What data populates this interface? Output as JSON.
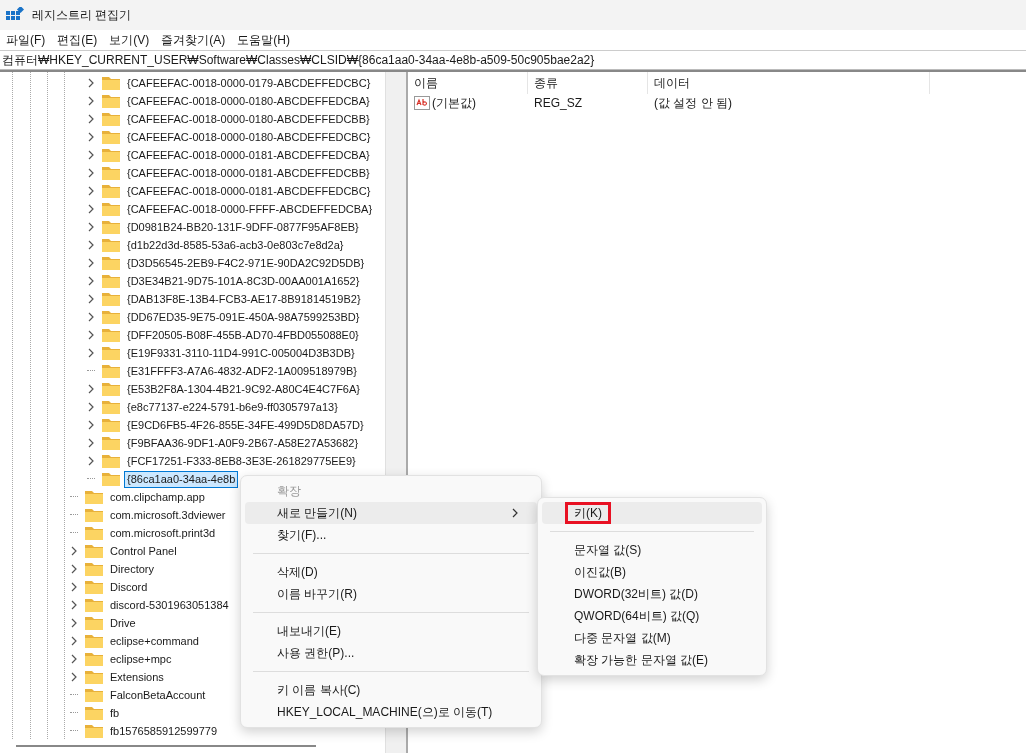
{
  "window": {
    "title": "레지스트리 편집기"
  },
  "menu_bar": [
    "파일(F)",
    "편집(E)",
    "보기(V)",
    "즐겨찾기(A)",
    "도움말(H)"
  ],
  "address": "컴퓨터₩HKEY_CURRENT_USER₩Software₩Classes₩CLSID₩{86ca1aa0-34aa-4e8b-a509-50c905bae2a2}",
  "tree": {
    "clsid_children": [
      {
        "label": "{CAFEEFAC-0018-0000-0179-ABCDEFFEDCBC}",
        "has_children": true,
        "selected": false
      },
      {
        "label": "{CAFEEFAC-0018-0000-0180-ABCDEFFEDCBA}",
        "has_children": true,
        "selected": false
      },
      {
        "label": "{CAFEEFAC-0018-0000-0180-ABCDEFFEDCBB}",
        "has_children": true,
        "selected": false
      },
      {
        "label": "{CAFEEFAC-0018-0000-0180-ABCDEFFEDCBC}",
        "has_children": true,
        "selected": false
      },
      {
        "label": "{CAFEEFAC-0018-0000-0181-ABCDEFFEDCBA}",
        "has_children": true,
        "selected": false
      },
      {
        "label": "{CAFEEFAC-0018-0000-0181-ABCDEFFEDCBB}",
        "has_children": true,
        "selected": false
      },
      {
        "label": "{CAFEEFAC-0018-0000-0181-ABCDEFFEDCBC}",
        "has_children": true,
        "selected": false
      },
      {
        "label": "{CAFEEFAC-0018-0000-FFFF-ABCDEFFEDCBA}",
        "has_children": true,
        "selected": false
      },
      {
        "label": "{D0981B24-BB20-131F-9DFF-0877F95AF8EB}",
        "has_children": true,
        "selected": false
      },
      {
        "label": "{d1b22d3d-8585-53a6-acb3-0e803c7e8d2a}",
        "has_children": true,
        "selected": false
      },
      {
        "label": "{D3D56545-2EB9-F4C2-971E-90DA2C92D5DB}",
        "has_children": true,
        "selected": false
      },
      {
        "label": "{D3E34B21-9D75-101A-8C3D-00AA001A1652}",
        "has_children": true,
        "selected": false
      },
      {
        "label": "{DAB13F8E-13B4-FCB3-AE17-8B91814519B2}",
        "has_children": true,
        "selected": false
      },
      {
        "label": "{DD67ED35-9E75-091E-450A-98A7599253BD}",
        "has_children": true,
        "selected": false
      },
      {
        "label": "{DFF20505-B08F-455B-AD70-4FBD055088E0}",
        "has_children": true,
        "selected": false
      },
      {
        "label": "{E19F9331-3110-11D4-991C-005004D3B3DB}",
        "has_children": true,
        "selected": false
      },
      {
        "label": "{E31FFFF3-A7A6-4832-ADF2-1A009518979B}",
        "has_children": false,
        "selected": false
      },
      {
        "label": "{E53B2F8A-1304-4B21-9C92-A80C4E4C7F6A}",
        "has_children": true,
        "selected": false
      },
      {
        "label": "{e8c77137-e224-5791-b6e9-ff0305797a13}",
        "has_children": true,
        "selected": false
      },
      {
        "label": "{E9CD6FB5-4F26-855E-34FE-499D5D8DA57D}",
        "has_children": true,
        "selected": false
      },
      {
        "label": "{F9BFAA36-9DF1-A0F9-2B67-A58E27A53682}",
        "has_children": true,
        "selected": false
      },
      {
        "label": "{FCF17251-F333-8EB8-3E3E-261829775EE9}",
        "has_children": true,
        "selected": false
      },
      {
        "label": "{86ca1aa0-34aa-4e8b",
        "has_children": false,
        "selected": true
      }
    ],
    "siblings": [
      {
        "label": "com.clipchamp.app",
        "has_children": false,
        "selected": false
      },
      {
        "label": "com.microsoft.3dviewer",
        "has_children": false,
        "selected": false
      },
      {
        "label": "com.microsoft.print3d",
        "has_children": false,
        "selected": false
      },
      {
        "label": "Control Panel",
        "has_children": true,
        "selected": false
      },
      {
        "label": "Directory",
        "has_children": true,
        "selected": false
      },
      {
        "label": "Discord",
        "has_children": true,
        "selected": false
      },
      {
        "label": "discord-5301963051384",
        "has_children": true,
        "selected": false
      },
      {
        "label": "Drive",
        "has_children": true,
        "selected": false
      },
      {
        "label": "eclipse+command",
        "has_children": true,
        "selected": false
      },
      {
        "label": "eclipse+mpc",
        "has_children": true,
        "selected": false
      },
      {
        "label": "Extensions",
        "has_children": true,
        "selected": false
      },
      {
        "label": "FalconBetaAccount",
        "has_children": false,
        "selected": false
      },
      {
        "label": "fb",
        "has_children": false,
        "selected": false
      },
      {
        "label": "fb1576585912599779",
        "has_children": false,
        "selected": false
      }
    ]
  },
  "values": {
    "columns": [
      "이름",
      "종류",
      "데이터"
    ],
    "rows": [
      {
        "name": "(기본값)",
        "type": "REG_SZ",
        "data": "(값 설정 안 됨)"
      }
    ]
  },
  "context_menu": {
    "items": [
      {
        "kind": "item",
        "label": "확장",
        "disabled": true,
        "hovered": false,
        "submenu": false
      },
      {
        "kind": "item",
        "label": "새로 만들기(N)",
        "disabled": false,
        "hovered": true,
        "submenu": true
      },
      {
        "kind": "item",
        "label": "찾기(F)...",
        "disabled": false,
        "hovered": false,
        "submenu": false
      },
      {
        "kind": "separator"
      },
      {
        "kind": "item",
        "label": "삭제(D)",
        "disabled": false,
        "hovered": false,
        "submenu": false
      },
      {
        "kind": "item",
        "label": "이름 바꾸기(R)",
        "disabled": false,
        "hovered": false,
        "submenu": false
      },
      {
        "kind": "separator"
      },
      {
        "kind": "item",
        "label": "내보내기(E)",
        "disabled": false,
        "hovered": false,
        "submenu": false
      },
      {
        "kind": "item",
        "label": "사용 권한(P)...",
        "disabled": false,
        "hovered": false,
        "submenu": false
      },
      {
        "kind": "separator"
      },
      {
        "kind": "item",
        "label": "키 이름 복사(C)",
        "disabled": false,
        "hovered": false,
        "submenu": false
      },
      {
        "kind": "item",
        "label": "HKEY_LOCAL_MACHINE(으)로 이동(T)",
        "disabled": false,
        "hovered": false,
        "submenu": false
      }
    ]
  },
  "submenu": {
    "items": [
      {
        "kind": "item",
        "label": "키(K)",
        "hovered": true,
        "highlighted": true
      },
      {
        "kind": "separator"
      },
      {
        "kind": "item",
        "label": "문자열 값(S)",
        "hovered": false,
        "highlighted": false
      },
      {
        "kind": "item",
        "label": "이진값(B)",
        "hovered": false,
        "highlighted": false
      },
      {
        "kind": "item",
        "label": "DWORD(32비트) 값(D)",
        "hovered": false,
        "highlighted": false
      },
      {
        "kind": "item",
        "label": "QWORD(64비트) 값(Q)",
        "hovered": false,
        "highlighted": false
      },
      {
        "kind": "item",
        "label": "다중 문자열 값(M)",
        "hovered": false,
        "highlighted": false
      },
      {
        "kind": "item",
        "label": "확장 가능한 문자열 값(E)",
        "hovered": false,
        "highlighted": false
      }
    ]
  }
}
